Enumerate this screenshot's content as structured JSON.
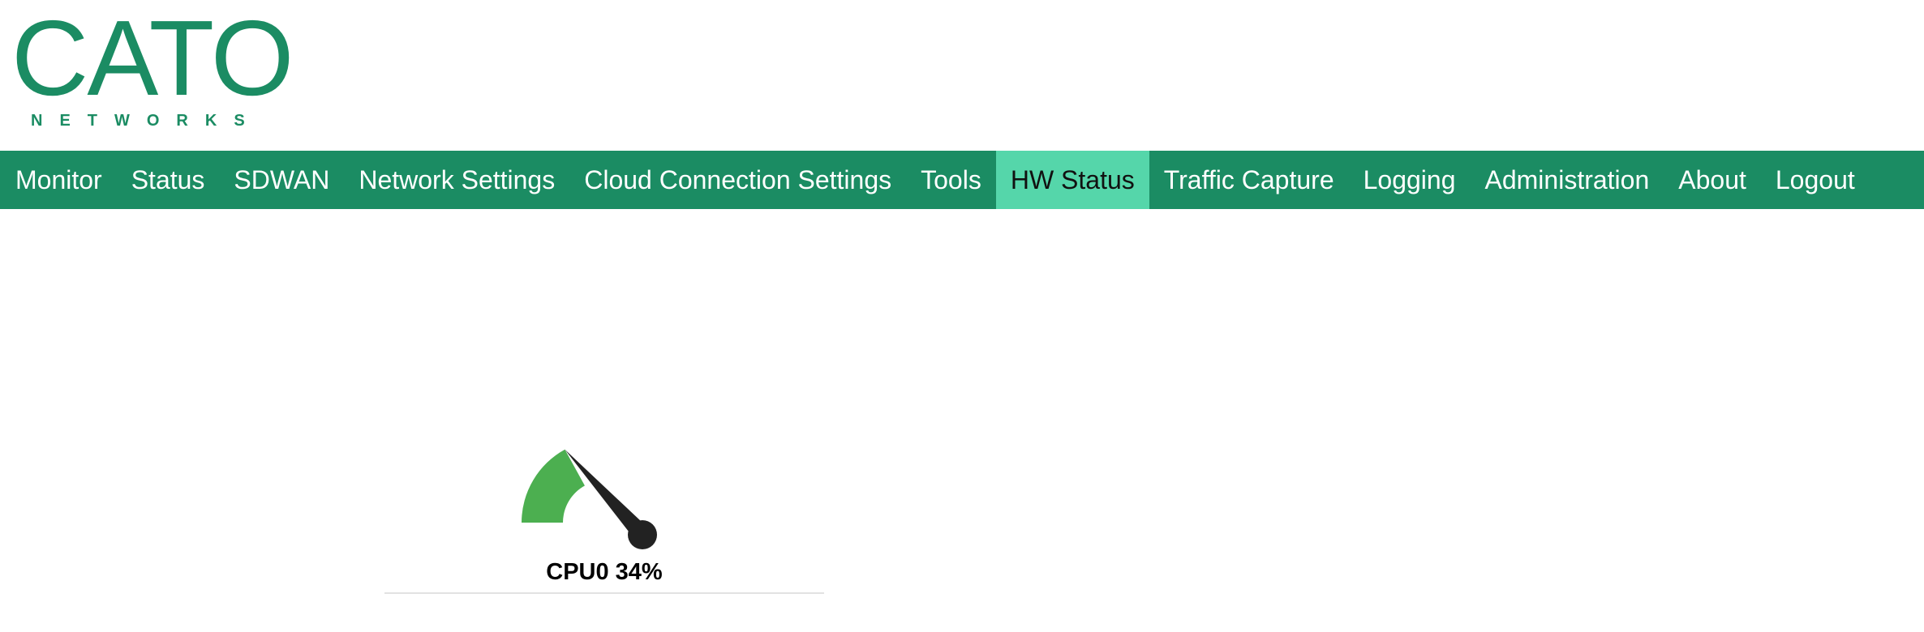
{
  "brand": {
    "logo_text": "CATO",
    "logo_subtext": "NETWORKS",
    "color": "#1b8c63"
  },
  "nav": {
    "items": [
      {
        "label": "Monitor",
        "active": false
      },
      {
        "label": "Status",
        "active": false
      },
      {
        "label": "SDWAN",
        "active": false
      },
      {
        "label": "Network Settings",
        "active": false
      },
      {
        "label": "Cloud Connection Settings",
        "active": false
      },
      {
        "label": "Tools",
        "active": false
      },
      {
        "label": "HW Status",
        "active": true
      },
      {
        "label": "Traffic Capture",
        "active": false
      },
      {
        "label": "Logging",
        "active": false
      },
      {
        "label": "Administration",
        "active": false
      },
      {
        "label": "About",
        "active": false
      },
      {
        "label": "Logout",
        "active": false
      }
    ],
    "bar_color": "#1b8c63",
    "active_color": "#55d6aa"
  },
  "gauge": {
    "name": "CPU0",
    "value_percent": 34,
    "label": "CPU0 34%",
    "fill_color": "#4caf50",
    "needle_color": "#222222"
  }
}
